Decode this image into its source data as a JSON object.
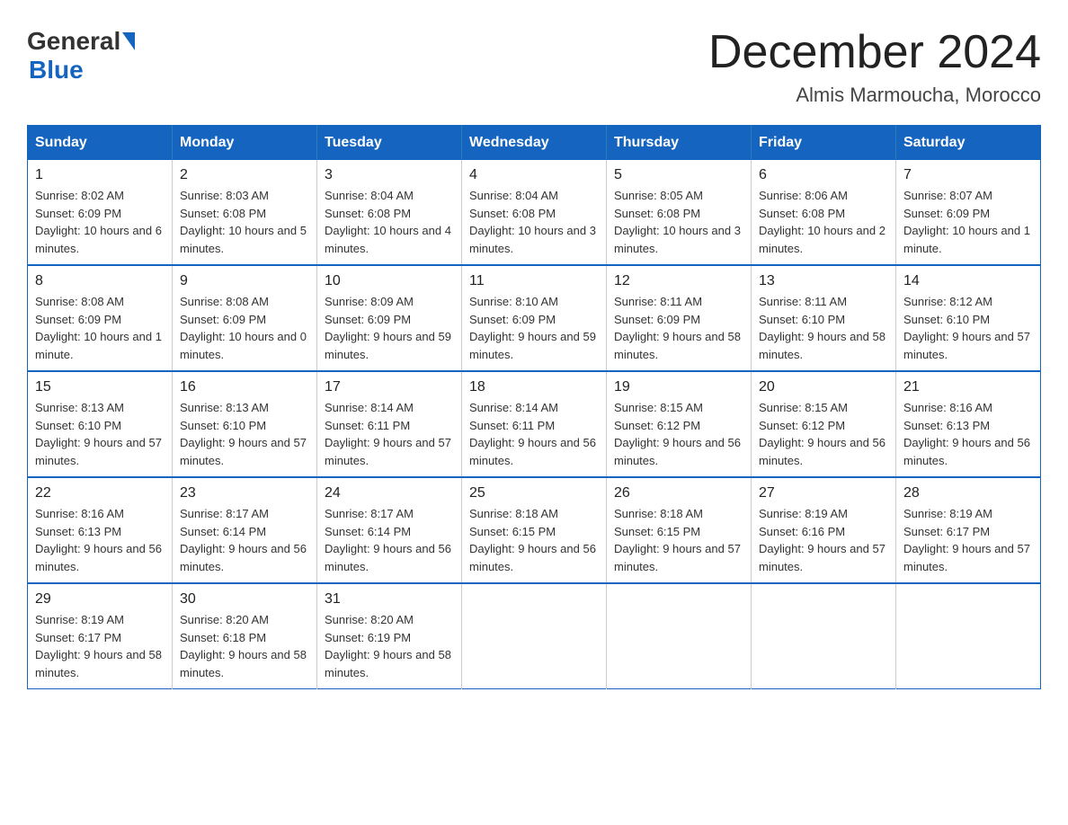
{
  "logo": {
    "general": "General",
    "blue": "Blue"
  },
  "title": "December 2024",
  "subtitle": "Almis Marmoucha, Morocco",
  "days_of_week": [
    "Sunday",
    "Monday",
    "Tuesday",
    "Wednesday",
    "Thursday",
    "Friday",
    "Saturday"
  ],
  "weeks": [
    [
      {
        "day": "1",
        "sunrise": "8:02 AM",
        "sunset": "6:09 PM",
        "daylight": "10 hours and 6 minutes."
      },
      {
        "day": "2",
        "sunrise": "8:03 AM",
        "sunset": "6:08 PM",
        "daylight": "10 hours and 5 minutes."
      },
      {
        "day": "3",
        "sunrise": "8:04 AM",
        "sunset": "6:08 PM",
        "daylight": "10 hours and 4 minutes."
      },
      {
        "day": "4",
        "sunrise": "8:04 AM",
        "sunset": "6:08 PM",
        "daylight": "10 hours and 3 minutes."
      },
      {
        "day": "5",
        "sunrise": "8:05 AM",
        "sunset": "6:08 PM",
        "daylight": "10 hours and 3 minutes."
      },
      {
        "day": "6",
        "sunrise": "8:06 AM",
        "sunset": "6:08 PM",
        "daylight": "10 hours and 2 minutes."
      },
      {
        "day": "7",
        "sunrise": "8:07 AM",
        "sunset": "6:09 PM",
        "daylight": "10 hours and 1 minute."
      }
    ],
    [
      {
        "day": "8",
        "sunrise": "8:08 AM",
        "sunset": "6:09 PM",
        "daylight": "10 hours and 1 minute."
      },
      {
        "day": "9",
        "sunrise": "8:08 AM",
        "sunset": "6:09 PM",
        "daylight": "10 hours and 0 minutes."
      },
      {
        "day": "10",
        "sunrise": "8:09 AM",
        "sunset": "6:09 PM",
        "daylight": "9 hours and 59 minutes."
      },
      {
        "day": "11",
        "sunrise": "8:10 AM",
        "sunset": "6:09 PM",
        "daylight": "9 hours and 59 minutes."
      },
      {
        "day": "12",
        "sunrise": "8:11 AM",
        "sunset": "6:09 PM",
        "daylight": "9 hours and 58 minutes."
      },
      {
        "day": "13",
        "sunrise": "8:11 AM",
        "sunset": "6:10 PM",
        "daylight": "9 hours and 58 minutes."
      },
      {
        "day": "14",
        "sunrise": "8:12 AM",
        "sunset": "6:10 PM",
        "daylight": "9 hours and 57 minutes."
      }
    ],
    [
      {
        "day": "15",
        "sunrise": "8:13 AM",
        "sunset": "6:10 PM",
        "daylight": "9 hours and 57 minutes."
      },
      {
        "day": "16",
        "sunrise": "8:13 AM",
        "sunset": "6:10 PM",
        "daylight": "9 hours and 57 minutes."
      },
      {
        "day": "17",
        "sunrise": "8:14 AM",
        "sunset": "6:11 PM",
        "daylight": "9 hours and 57 minutes."
      },
      {
        "day": "18",
        "sunrise": "8:14 AM",
        "sunset": "6:11 PM",
        "daylight": "9 hours and 56 minutes."
      },
      {
        "day": "19",
        "sunrise": "8:15 AM",
        "sunset": "6:12 PM",
        "daylight": "9 hours and 56 minutes."
      },
      {
        "day": "20",
        "sunrise": "8:15 AM",
        "sunset": "6:12 PM",
        "daylight": "9 hours and 56 minutes."
      },
      {
        "day": "21",
        "sunrise": "8:16 AM",
        "sunset": "6:13 PM",
        "daylight": "9 hours and 56 minutes."
      }
    ],
    [
      {
        "day": "22",
        "sunrise": "8:16 AM",
        "sunset": "6:13 PM",
        "daylight": "9 hours and 56 minutes."
      },
      {
        "day": "23",
        "sunrise": "8:17 AM",
        "sunset": "6:14 PM",
        "daylight": "9 hours and 56 minutes."
      },
      {
        "day": "24",
        "sunrise": "8:17 AM",
        "sunset": "6:14 PM",
        "daylight": "9 hours and 56 minutes."
      },
      {
        "day": "25",
        "sunrise": "8:18 AM",
        "sunset": "6:15 PM",
        "daylight": "9 hours and 56 minutes."
      },
      {
        "day": "26",
        "sunrise": "8:18 AM",
        "sunset": "6:15 PM",
        "daylight": "9 hours and 57 minutes."
      },
      {
        "day": "27",
        "sunrise": "8:19 AM",
        "sunset": "6:16 PM",
        "daylight": "9 hours and 57 minutes."
      },
      {
        "day": "28",
        "sunrise": "8:19 AM",
        "sunset": "6:17 PM",
        "daylight": "9 hours and 57 minutes."
      }
    ],
    [
      {
        "day": "29",
        "sunrise": "8:19 AM",
        "sunset": "6:17 PM",
        "daylight": "9 hours and 58 minutes."
      },
      {
        "day": "30",
        "sunrise": "8:20 AM",
        "sunset": "6:18 PM",
        "daylight": "9 hours and 58 minutes."
      },
      {
        "day": "31",
        "sunrise": "8:20 AM",
        "sunset": "6:19 PM",
        "daylight": "9 hours and 58 minutes."
      },
      {
        "day": "",
        "sunrise": "",
        "sunset": "",
        "daylight": ""
      },
      {
        "day": "",
        "sunrise": "",
        "sunset": "",
        "daylight": ""
      },
      {
        "day": "",
        "sunrise": "",
        "sunset": "",
        "daylight": ""
      },
      {
        "day": "",
        "sunrise": "",
        "sunset": "",
        "daylight": ""
      }
    ]
  ],
  "labels": {
    "sunrise": "Sunrise:",
    "sunset": "Sunset:",
    "daylight": "Daylight:"
  }
}
